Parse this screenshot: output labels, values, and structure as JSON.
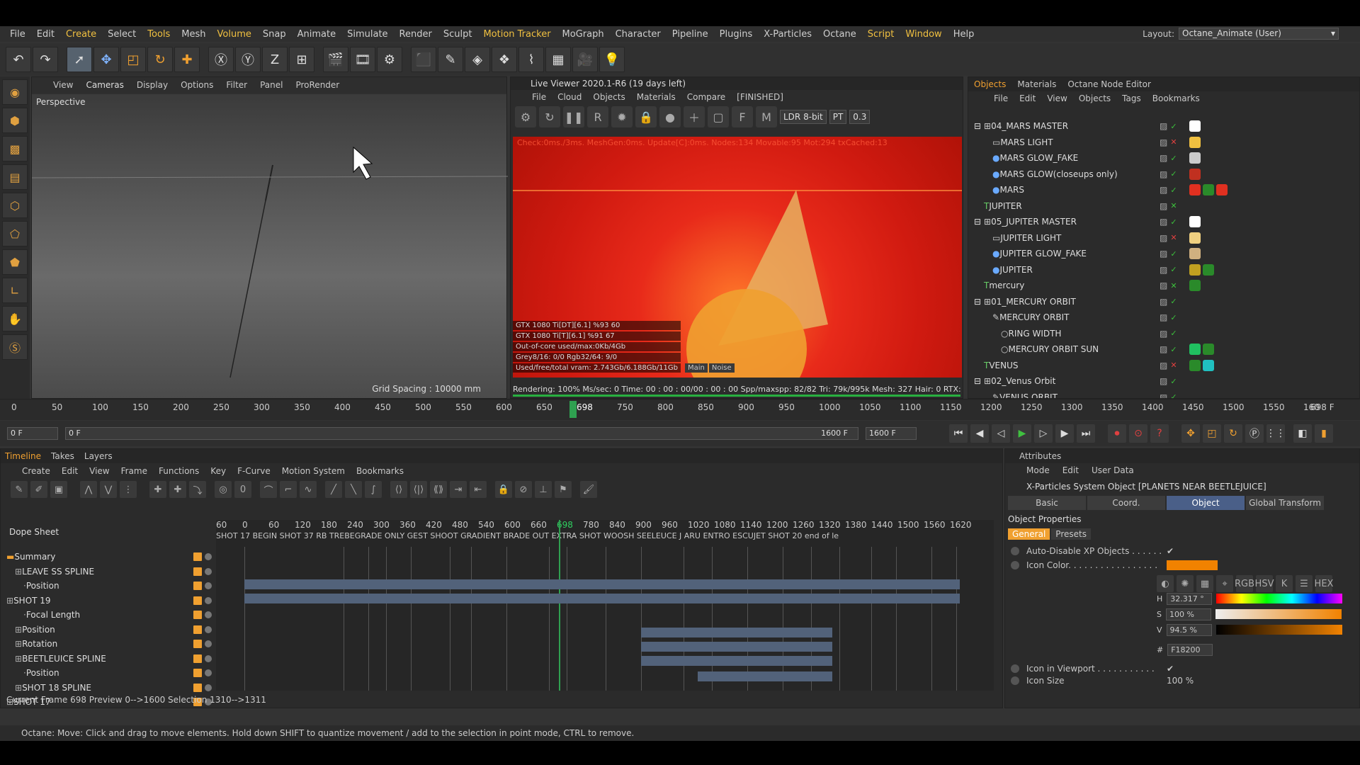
{
  "menu": {
    "items": [
      "File",
      "Edit",
      "Create",
      "Select",
      "Tools",
      "Mesh",
      "Volume",
      "Snap",
      "Animate",
      "Simulate",
      "Render",
      "Sculpt",
      "Motion Tracker",
      "MoGraph",
      "Character",
      "Pipeline",
      "Plugins",
      "X-Particles",
      "Octane",
      "Script",
      "Window",
      "Help"
    ],
    "layout_label": "Layout:",
    "layout_value": "Octane_Animate (User)"
  },
  "viewport": {
    "menu": [
      "View",
      "Cameras",
      "Display",
      "Options",
      "Filter",
      "Panel",
      "ProRender"
    ],
    "label": "Perspective",
    "grid_spacing": "Grid Spacing : 10000 mm"
  },
  "live_viewer": {
    "title": "Live Viewer 2020.1-R6 (19 days left)",
    "menu": [
      "File",
      "Cloud",
      "Objects",
      "Materials",
      "Compare"
    ],
    "status_tag": "[FINISHED]",
    "ldr": "LDR 8-bit",
    "mode": "PT",
    "value": "0.3",
    "check_line": "Check:0ms./3ms. MeshGen:0ms. Update[C]:0ms. Nodes:134 Movable:95 Mot:294 txCached:13",
    "stats": [
      "GTX 1080 Ti[DT][6.1]   %93   60",
      "GTX 1080 Ti[T][6.1]   %91   67",
      "Out-of-core used/max:0Kb/4Gb",
      "Grey8/16: 0/0        Rgb32/64: 9/0",
      "Used/free/total vram: 2.743Gb/6.188Gb/11Gb"
    ],
    "main": "Main",
    "noise": "Noise",
    "render_status": "Rendering: 100% Ms/sec: 0   Time: 00 : 00 : 00/00 : 00 : 00   Spp/maxspp: 82/82   Tri: 79k/995k   Mesh: 327   Hair: 0   RTX:off"
  },
  "objects": {
    "tabs": [
      "Objects",
      "Materials",
      "Octane Node Editor"
    ],
    "menu": [
      "File",
      "Edit",
      "View",
      "Objects",
      "Tags",
      "Bookmarks"
    ],
    "rows": [
      {
        "name": "04_MARS MASTER",
        "indent": 0,
        "kind": "L0"
      },
      {
        "name": "MARS LIGHT",
        "indent": 1,
        "kind": "light"
      },
      {
        "name": "MARS GLOW_FAKE",
        "indent": 1,
        "kind": "sphere"
      },
      {
        "name": "MARS GLOW(closeups only)",
        "indent": 1,
        "kind": "sphere"
      },
      {
        "name": "MARS",
        "indent": 1,
        "kind": "sphere"
      },
      {
        "name": "JUPITER",
        "indent": 0,
        "kind": "text"
      },
      {
        "name": "05_JUPITER MASTER",
        "indent": 0,
        "kind": "L0"
      },
      {
        "name": "JUPITER LIGHT",
        "indent": 1,
        "kind": "light"
      },
      {
        "name": "JUPITER GLOW_FAKE",
        "indent": 1,
        "kind": "sphere"
      },
      {
        "name": "JUPITER",
        "indent": 1,
        "kind": "sphere"
      },
      {
        "name": "mercury",
        "indent": 0,
        "kind": "text"
      },
      {
        "name": "01_MERCURY ORBIT",
        "indent": 0,
        "kind": "L0"
      },
      {
        "name": "MERCURY ORBIT",
        "indent": 1,
        "kind": "spline"
      },
      {
        "name": "RING WIDTH",
        "indent": 2,
        "kind": "circle"
      },
      {
        "name": "MERCURY ORBIT SUN",
        "indent": 2,
        "kind": "circle"
      },
      {
        "name": "VENUS",
        "indent": 0,
        "kind": "text"
      },
      {
        "name": "02_Venus Orbit",
        "indent": 0,
        "kind": "L0"
      },
      {
        "name": "VENUS ORBIT",
        "indent": 1,
        "kind": "spline"
      }
    ]
  },
  "ruler": {
    "ticks": [
      "0",
      "50",
      "100",
      "150",
      "200",
      "250",
      "300",
      "350",
      "400",
      "450",
      "500",
      "550",
      "600",
      "650",
      "698",
      "750",
      "800",
      "850",
      "900",
      "950",
      "1000",
      "1050",
      "1100",
      "1150",
      "1200",
      "1250",
      "1300",
      "1350",
      "1400",
      "1450",
      "1500",
      "1550",
      "160"
    ],
    "end": "698 F"
  },
  "transport": {
    "current": "0 F",
    "start": "0 F",
    "max": "1600 F",
    "end": "1600 F"
  },
  "timeline": {
    "tabs": [
      "Timeline",
      "Takes",
      "Layers"
    ],
    "menu": [
      "Create",
      "Edit",
      "View",
      "Frame",
      "Functions",
      "Key",
      "F-Curve",
      "Motion System",
      "Bookmarks"
    ],
    "dope_sheet": "Dope Sheet",
    "ruler": [
      "60",
      "0",
      "60",
      "120",
      "180",
      "240",
      "300",
      "360",
      "420",
      "480",
      "540",
      "600",
      "660",
      "698",
      "780",
      "840",
      "900",
      "960",
      "1020",
      "1080",
      "1140",
      "1200",
      "1260",
      "1320",
      "1380",
      "1440",
      "1500",
      "1560",
      "1620"
    ],
    "markers": "SHOT 17 BEGIN        SHOT 37 RB TREBEGRADE ONLY  GEST SHOOT GRADIENT BRADE OUT  EXTRA SHOT WOOSH   SEELEUCE  J  ARU ENTRO  ESCUJET SHOT 20   end of le",
    "tracks": [
      {
        "name": "Summary",
        "indent": 0
      },
      {
        "name": "LEAVE SS SPLINE",
        "indent": 1
      },
      {
        "name": "Position",
        "indent": 2
      },
      {
        "name": "SHOT 19",
        "indent": 0
      },
      {
        "name": "Focal Length",
        "indent": 2
      },
      {
        "name": "Position",
        "indent": 1
      },
      {
        "name": "Rotation",
        "indent": 1
      },
      {
        "name": "BEETLEUICE SPLINE",
        "indent": 1
      },
      {
        "name": "Position",
        "indent": 2
      },
      {
        "name": "SHOT 18 SPLINE",
        "indent": 1
      },
      {
        "name": "SHOT 17",
        "indent": 0
      }
    ],
    "status": "Current Frame  698  Preview  0-->1600   Selection 1310-->1311"
  },
  "attributes": {
    "title": "Attributes",
    "menu": [
      "Mode",
      "Edit",
      "User Data"
    ],
    "object_name": "X-Particles System Object [PLANETS NEAR BEETLEJUICE]",
    "tabs": [
      "Basic",
      "Coord.",
      "Object",
      "Global Transform"
    ],
    "props_header": "Object Properties",
    "subtabs": [
      "General",
      "Presets"
    ],
    "auto_disable": "Auto-Disable XP Objects . . . . . .",
    "icon_color": "Icon Color. . . . . . . . . . . . . . . . .",
    "icon_color_value": "#f18200",
    "h_label": "H",
    "h_value": "32.317 °",
    "s_label": "S",
    "s_value": "100 %",
    "v_label": "V",
    "v_value": "94.5 %",
    "hex_label": "#",
    "hex_value": "F18200",
    "icon_viewport": "Icon in Viewport . . . . . . . . . . .",
    "icon_size": "Icon Size",
    "icon_size_value": "100 %"
  },
  "statusbar": "Octane:    Move: Click and drag to move elements. Hold down SHIFT to quantize movement / add to the selection in point mode, CTRL to remove."
}
